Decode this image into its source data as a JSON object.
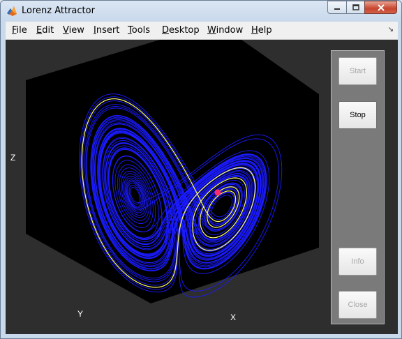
{
  "window": {
    "title": "Lorenz Attractor"
  },
  "menu": {
    "file": {
      "u": "F",
      "rest": "ile"
    },
    "edit": {
      "u": "E",
      "rest": "dit"
    },
    "view": {
      "u": "V",
      "rest": "iew"
    },
    "insert": {
      "u": "I",
      "rest": "nsert"
    },
    "tools": {
      "u": "T",
      "rest": "ools"
    },
    "desktop": {
      "u": "D",
      "rest": "esktop"
    },
    "window": {
      "u": "W",
      "rest": "indow"
    },
    "help": {
      "u": "H",
      "rest": "elp"
    }
  },
  "axes": {
    "x_label": "X",
    "y_label": "Y",
    "z_label": "Z"
  },
  "buttons": {
    "start": "Start",
    "stop": "Stop",
    "info": "Info",
    "close": "Close"
  },
  "colors": {
    "trajectory": "#1a1aff",
    "highlight": "#ffff66",
    "marker": "#ff2a6a",
    "axes_bg": "#000000",
    "figure_bg": "#2e2e2e"
  },
  "icons": {
    "app": "matlab-membrane-icon",
    "minimize": "minimize-icon",
    "maximize": "maximize-icon",
    "close": "close-icon",
    "dock": "dock-arrow-icon"
  }
}
